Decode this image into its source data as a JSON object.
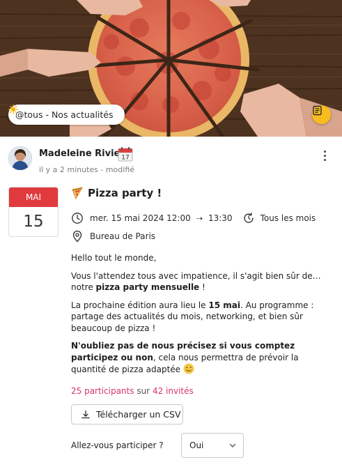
{
  "hero": {
    "channel_label": "@tous - Nos actualités",
    "channel_icon": "sun-emoji-icon",
    "action_icon": "note-icon",
    "accent": "#f7bd1e"
  },
  "author": {
    "name": "Madeleine Riviera",
    "badge_icon": "calendar-emoji-icon",
    "time": "il y a 2 minutes",
    "edited": "- modifié"
  },
  "event": {
    "month": "MAI",
    "day": "15",
    "month_color": "#e03a3f",
    "title": "Pizza party !",
    "title_icon": "pizza-emoji-icon",
    "start": "mer. 15 mai 2024 12:00",
    "arrow": "⇢",
    "end": "13:30",
    "recurrence": "Tous les mois",
    "location": "Bureau de Paris"
  },
  "description": {
    "p1": "Hello tout le monde,",
    "p2_a": "Vous l'attendez tous avec impatience, il s'agit bien sûr de… notre ",
    "p2_b": "pizza party mensuelle",
    "p2_c": " !",
    "p3_a": "La prochaine édition aura lieu le ",
    "p3_b": "15 mai",
    "p3_c": ". Au programme : partage des actualités du mois, networking, et bien sûr beaucoup de pizza !",
    "p4_a": "N'oubliez pas de nous précisez si vous comptez participez ou non",
    "p4_b": ", cela nous permettra de prévoir la quantité de pizza adaptée",
    "p4_emoji": "😉"
  },
  "participants": {
    "count": "25 participants",
    "sep": "sur",
    "invited": "42 invités",
    "highlight_color": "#d6336c"
  },
  "actions": {
    "download_label": "Télécharger un CSV",
    "rsvp_label": "Allez-vous participer ?",
    "rsvp_value": "Oui"
  }
}
